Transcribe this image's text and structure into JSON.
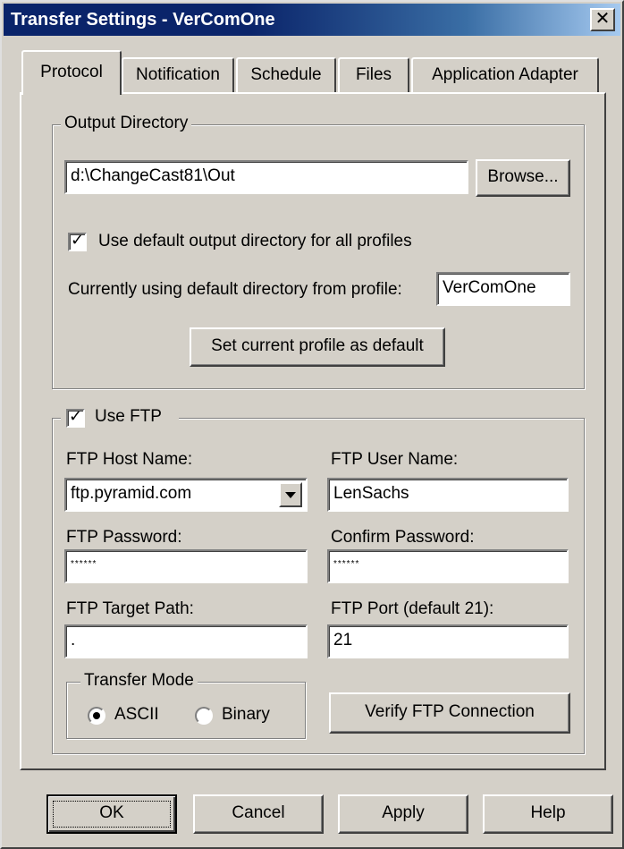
{
  "window": {
    "title": "Transfer Settings - VerComOne",
    "close_glyph": "✕"
  },
  "tabs": [
    {
      "label": "Protocol",
      "active": true
    },
    {
      "label": "Notification",
      "active": false
    },
    {
      "label": "Schedule",
      "active": false
    },
    {
      "label": "Files",
      "active": false
    },
    {
      "label": "Application Adapter",
      "active": false
    }
  ],
  "output_directory": {
    "legend": "Output Directory",
    "path_value": "d:\\ChangeCast81\\Out",
    "browse_label": "Browse...",
    "use_default_label": "Use default output directory for all profiles",
    "use_default_checked": true,
    "current_default_label": "Currently using default directory from profile:",
    "current_default_value": "VerComOne",
    "set_default_label": "Set current profile as default"
  },
  "ftp": {
    "use_ftp_label": "Use FTP",
    "use_ftp_checked": true,
    "host_label": "FTP Host Name:",
    "host_value": "ftp.pyramid.com",
    "user_label": "FTP User Name:",
    "user_value": "LenSachs",
    "password_label": "FTP Password:",
    "password_value": "******",
    "confirm_label": "Confirm Password:",
    "confirm_value": "******",
    "target_path_label": "FTP Target Path:",
    "target_path_value": ".",
    "port_label": "FTP Port (default 21):",
    "port_value": "21",
    "transfer_mode": {
      "legend": "Transfer Mode",
      "ascii_label": "ASCII",
      "binary_label": "Binary",
      "selected": "ASCII"
    },
    "verify_label": "Verify FTP Connection"
  },
  "footer": {
    "ok_label": "OK",
    "cancel_label": "Cancel",
    "apply_label": "Apply",
    "help_label": "Help"
  },
  "icons": {
    "checkbox": "check-icon",
    "dropdown": "chevron-down-icon",
    "close": "close-icon"
  }
}
